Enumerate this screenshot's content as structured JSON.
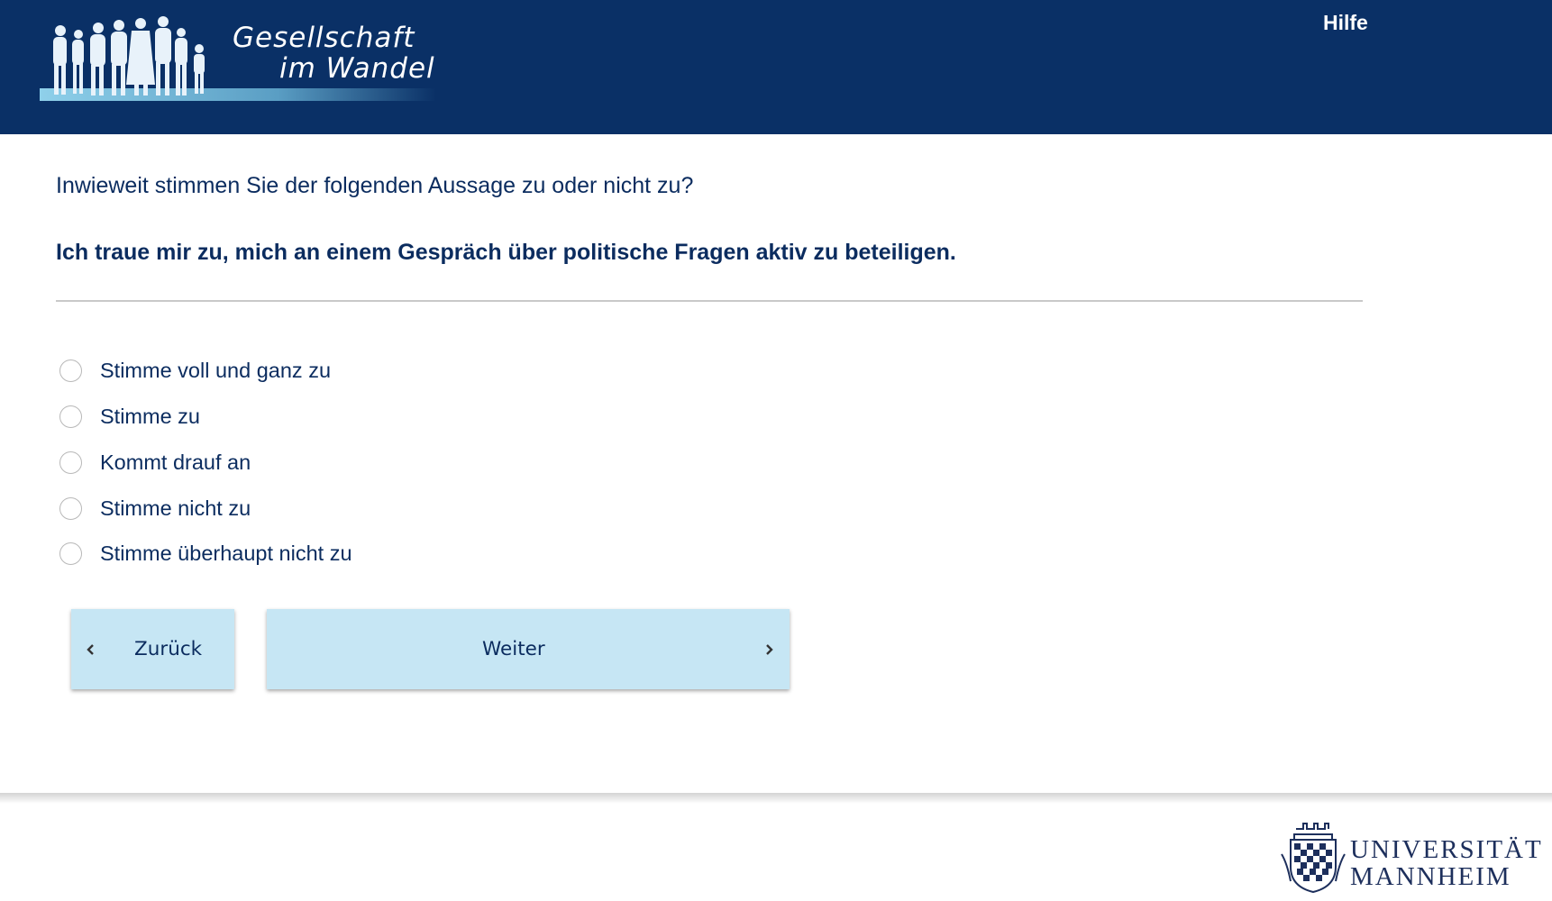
{
  "header": {
    "logo_title": "Gesellschaft",
    "logo_subtitle": "im Wandel",
    "help_label": "Hilfe"
  },
  "question": {
    "prompt": "Inwieweit stimmen Sie der folgenden Aussage zu oder nicht zu?",
    "statement": "Ich traue mir zu, mich an einem Gespräch über politische Fragen aktiv zu beteiligen.",
    "options": [
      {
        "label": "Stimme voll und ganz zu",
        "selected": false
      },
      {
        "label": "Stimme zu",
        "selected": false
      },
      {
        "label": "Kommt drauf an",
        "selected": false
      },
      {
        "label": "Stimme nicht zu",
        "selected": false
      },
      {
        "label": "Stimme überhaupt nicht zu",
        "selected": false
      }
    ]
  },
  "navigation": {
    "back_label": "Zurück",
    "next_label": "Weiter"
  },
  "footer": {
    "university_line1": "UNIVERSITÄT",
    "university_line2": "MANNHEIM"
  },
  "colors": {
    "header_bg": "#0a3066",
    "text": "#0b2c5f",
    "button_bg": "#c6e6f4"
  }
}
